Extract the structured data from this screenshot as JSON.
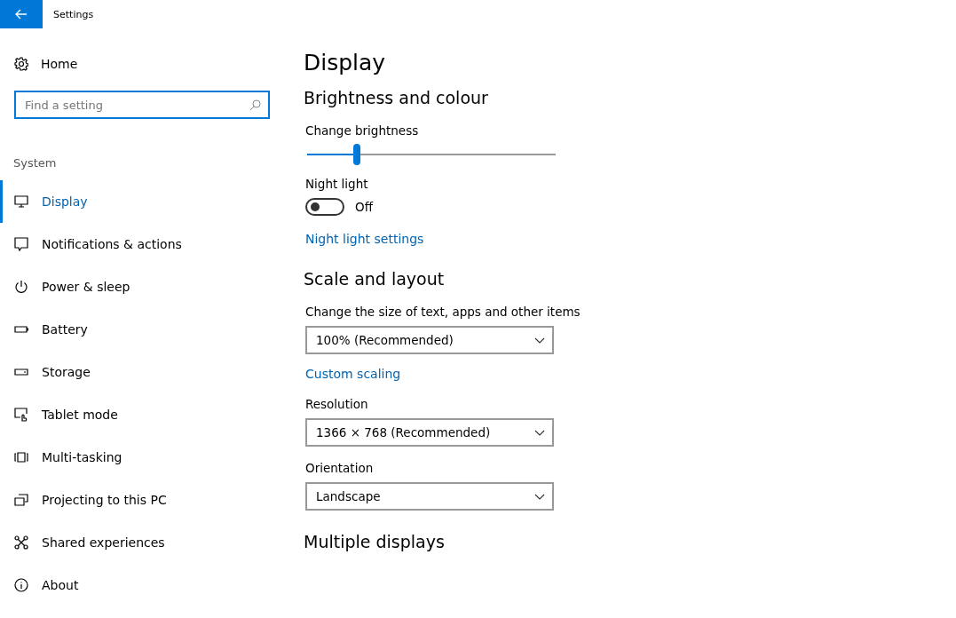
{
  "window": {
    "title": "Settings"
  },
  "sidebar": {
    "home": "Home",
    "search": {
      "placeholder": "Find a setting"
    },
    "group": "System",
    "items": [
      {
        "label": "Display",
        "selected": true
      },
      {
        "label": "Notifications & actions",
        "selected": false
      },
      {
        "label": "Power & sleep",
        "selected": false
      },
      {
        "label": "Battery",
        "selected": false
      },
      {
        "label": "Storage",
        "selected": false
      },
      {
        "label": "Tablet mode",
        "selected": false
      },
      {
        "label": "Multi-tasking",
        "selected": false
      },
      {
        "label": "Projecting to this PC",
        "selected": false
      },
      {
        "label": "Shared experiences",
        "selected": false
      },
      {
        "label": "About",
        "selected": false
      }
    ]
  },
  "page": {
    "title": "Display",
    "sections": [
      {
        "heading": "Brightness and colour",
        "controls": [
          {
            "kind": "slider",
            "label": "Change brightness",
            "level": 0.2
          },
          {
            "kind": "toggle",
            "label": "Night light",
            "on": false,
            "state_text": "Off"
          },
          {
            "kind": "link",
            "label": "Night light settings"
          }
        ]
      },
      {
        "heading": "Scale and layout",
        "controls": [
          {
            "kind": "dropdown",
            "label": "Change the size of text, apps and other items",
            "value": "100% (Recommended)"
          },
          {
            "kind": "link",
            "label": "Custom scaling"
          },
          {
            "kind": "dropdown",
            "label": "Resolution",
            "value": "1366 × 768 (Recommended)"
          },
          {
            "kind": "dropdown",
            "label": "Orientation",
            "value": "Landscape"
          }
        ]
      },
      {
        "heading": "Multiple displays"
      }
    ]
  }
}
